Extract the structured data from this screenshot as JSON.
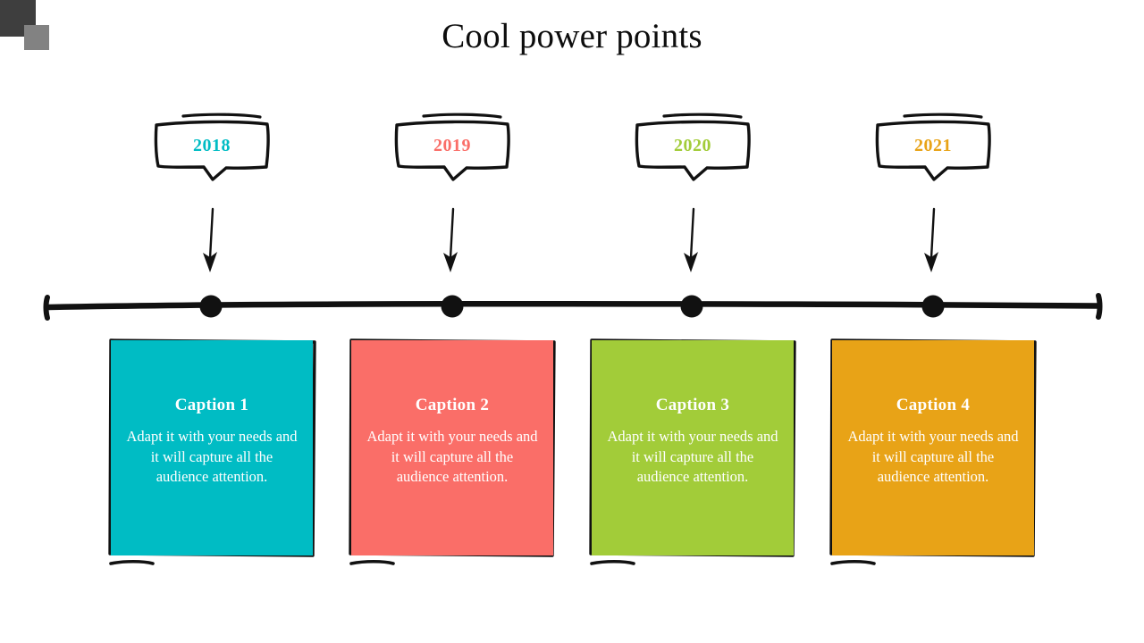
{
  "slide": {
    "title": "Cool power points",
    "background": "#ffffff"
  },
  "decor": {
    "corner_dark_color": "#3e3e3e",
    "corner_light_color": "#828282"
  },
  "timeline": {
    "line_color": "#111111",
    "marker_shape": "filled-circle",
    "end_cap_shape": "vertical-tick",
    "markers": 4
  },
  "milestones": [
    {
      "year": "2018",
      "year_color": "#00bcc4",
      "card_color": "#00bcc4",
      "caption": "Caption 1",
      "body": "Adapt it with your needs and it will capture all the audience attention."
    },
    {
      "year": "2019",
      "year_color": "#fa6e68",
      "card_color": "#fa6e68",
      "caption": "Caption 2",
      "body": "Adapt it with your needs and it will capture all the audience attention."
    },
    {
      "year": "2020",
      "year_color": "#a2cc39",
      "card_color": "#a2cc39",
      "caption": "Caption 3",
      "body": "Adapt it with your needs and it will capture all the audience attention."
    },
    {
      "year": "2021",
      "year_color": "#e8a317",
      "card_color": "#e8a317",
      "caption": "Caption 4",
      "body": "Adapt it with your needs and it will capture all the audience attention."
    }
  ]
}
